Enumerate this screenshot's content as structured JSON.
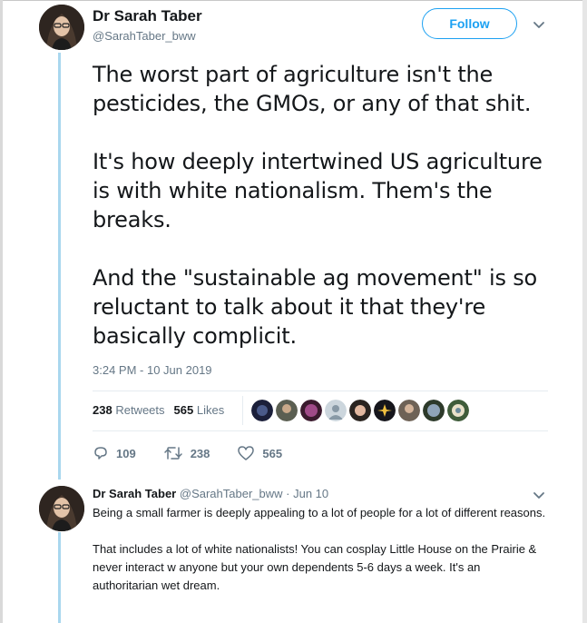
{
  "tweet": {
    "author": {
      "display_name": "Dr Sarah Taber",
      "handle": "@SarahTaber_bww"
    },
    "follow_label": "Follow",
    "paragraphs": [
      "The worst part of agriculture isn't the pesticides, the GMOs, or any of that shit.",
      "It's how deeply intertwined US agriculture is with white nationalism. Them's the breaks.",
      "And the \"sustainable ag movement\" is so reluctant to talk about it that they're basically complicit."
    ],
    "timestamp": "3:24 PM - 10 Jun 2019",
    "stats": {
      "retweets_count": "238",
      "retweets_label": "Retweets",
      "likes_count": "565",
      "likes_label": "Likes"
    },
    "actions": {
      "replies": "109",
      "retweets": "238",
      "likes": "565"
    },
    "liker_avatar_count": 9
  },
  "reply": {
    "display_name": "Dr Sarah Taber",
    "handle": "@SarahTaber_bww",
    "date": "· Jun 10",
    "paragraphs": [
      "Being a small farmer is deeply appealing to a lot of people for a lot of different reasons.",
      "That includes a lot of white nationalists! You can cosplay Little House on the Prairie & never interact w anyone but your own dependents 5-6 days a week. It's an authoritarian wet dream."
    ]
  },
  "colors": {
    "accent": "#1da1f2",
    "thread_line": "#a9d7ee",
    "muted_text": "#657786",
    "text": "#14171a"
  },
  "icons": [
    "chevron-down-icon",
    "reply-icon",
    "retweet-icon",
    "heart-icon"
  ]
}
